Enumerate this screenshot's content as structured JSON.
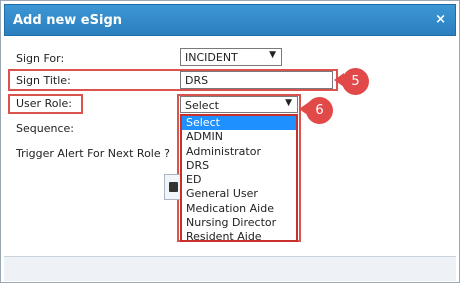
{
  "dialog": {
    "title": "Add new eSign",
    "close_glyph": "×"
  },
  "form": {
    "sign_for_label": "Sign For:",
    "sign_for_value": "INCIDENT",
    "sign_title_label": "Sign Title:",
    "sign_title_value": "DRS",
    "user_role_label": "User Role:",
    "user_role_value": "Select",
    "sequence_label": "Sequence:",
    "trigger_label": "Trigger Alert For Next Role ?"
  },
  "dropdown": {
    "options": [
      "Select",
      "ADMIN",
      "Administrator",
      "DRS",
      "ED",
      "General User",
      "Medication Aide",
      "Nursing Director",
      "Resident Aide"
    ],
    "highlighted": "Select"
  },
  "callouts": {
    "c5": "5",
    "c6": "6"
  },
  "colors": {
    "titlebar": "#2b7fbf",
    "highlight_box": "#d9534f",
    "callout": "#e24a4a",
    "selected_option": "#1e90ff"
  }
}
